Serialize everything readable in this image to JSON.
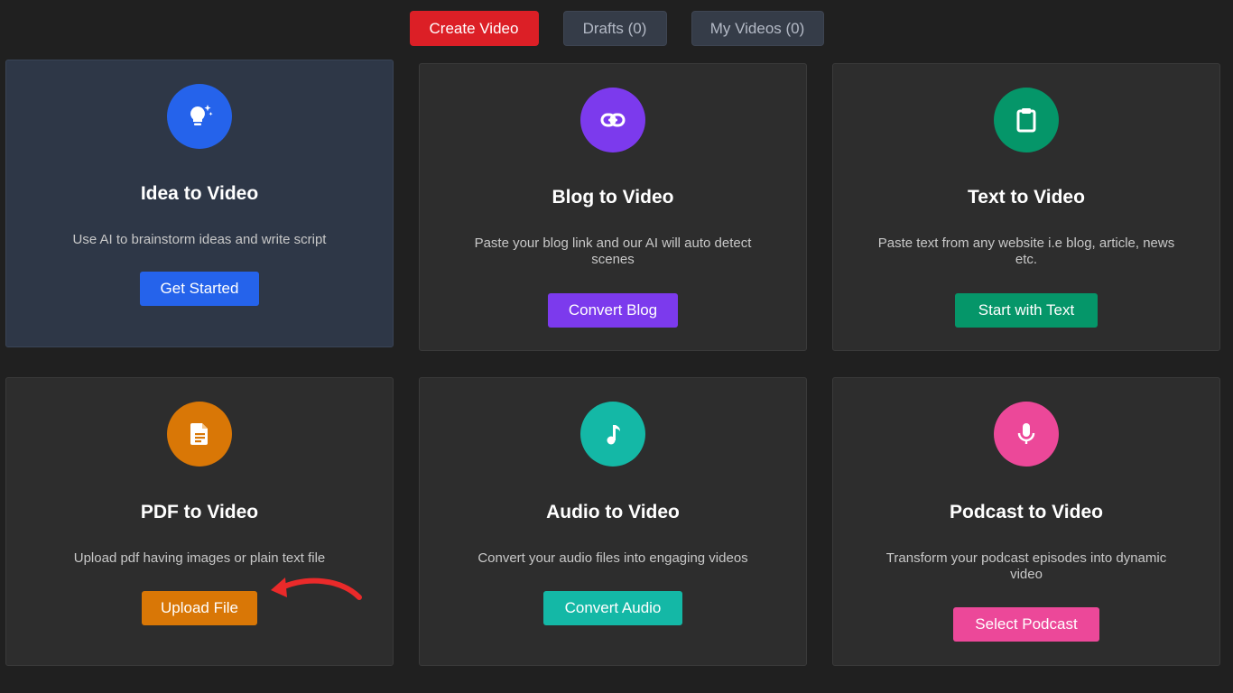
{
  "tabs": {
    "create": "Create Video",
    "drafts": "Drafts (0)",
    "my_videos": "My Videos (0)"
  },
  "cards": [
    {
      "title": "Idea to Video",
      "description": "Use AI to brainstorm ideas and write script",
      "button": "Get Started",
      "icon": "lightbulb-sparkle-icon",
      "color": "#2563eb"
    },
    {
      "title": "Blog to Video",
      "description": "Paste your blog link and our AI will auto detect scenes",
      "button": "Convert Blog",
      "icon": "link-icon",
      "color": "#7c3aed"
    },
    {
      "title": "Text to Video",
      "description": "Paste text from any website i.e blog, article, news etc.",
      "button": "Start with Text",
      "icon": "clipboard-icon",
      "color": "#059669"
    },
    {
      "title": "PDF to Video",
      "description": "Upload pdf having images or plain text file",
      "button": "Upload File",
      "icon": "document-icon",
      "color": "#d97706"
    },
    {
      "title": "Audio to Video",
      "description": "Convert your audio files into engaging videos",
      "button": "Convert Audio",
      "icon": "music-note-icon",
      "color": "#14b8a6"
    },
    {
      "title": "Podcast to Video",
      "description": "Transform your podcast episodes into dynamic video",
      "button": "Select Podcast",
      "icon": "microphone-icon",
      "color": "#ec4899"
    }
  ],
  "accent": {
    "create_tab": "#dc1f26",
    "annotation_arrow": "#ea2a2a"
  }
}
